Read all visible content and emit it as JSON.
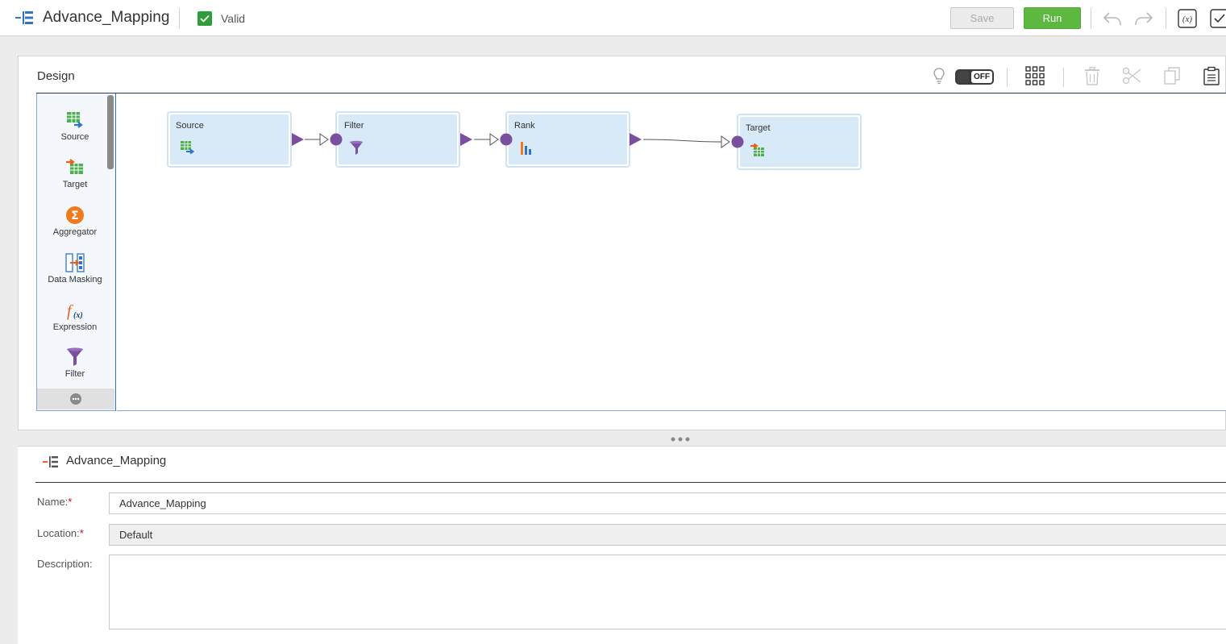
{
  "header": {
    "title": "Advance_Mapping",
    "status": "Valid",
    "save_label": "Save",
    "run_label": "Run"
  },
  "design": {
    "title": "Design",
    "toggle_label": "OFF"
  },
  "palette": {
    "items": [
      {
        "label": "Source"
      },
      {
        "label": "Target"
      },
      {
        "label": "Aggregator"
      },
      {
        "label": "Data Masking"
      },
      {
        "label": "Expression"
      },
      {
        "label": "Filter"
      }
    ]
  },
  "canvas": {
    "nodes": [
      {
        "label": "Source"
      },
      {
        "label": "Filter"
      },
      {
        "label": "Rank"
      },
      {
        "label": "Target"
      }
    ]
  },
  "properties": {
    "title": "Advance_Mapping",
    "name_label": "Name:",
    "name_value": "Advance_Mapping",
    "location_label": "Location:",
    "location_value": "Default",
    "description_label": "Description:",
    "required_mark": "*"
  },
  "colors": {
    "run_button": "#5cb83e",
    "valid_check": "#2e9d3a",
    "node_fill": "#d8e9f8",
    "port": "#7b4fa0"
  },
  "icons": [
    "mapping-icon",
    "valid-check-icon",
    "undo-icon",
    "redo-icon",
    "expression-icon",
    "validate-icon",
    "lightbulb-icon",
    "grid-icon",
    "delete-icon",
    "cut-icon",
    "copy-icon",
    "paste-icon"
  ]
}
